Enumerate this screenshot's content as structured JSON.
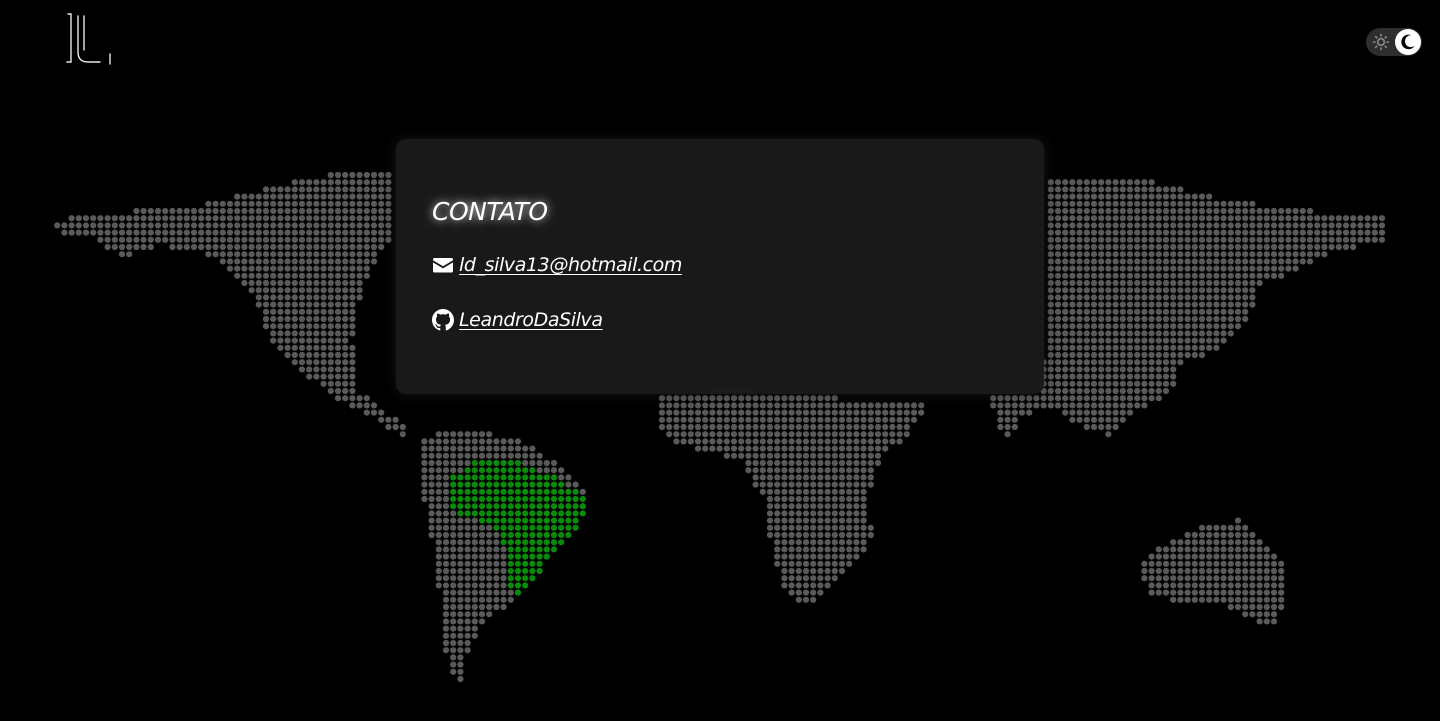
{
  "header": {
    "logo_icon": "ld-monogram-logo",
    "theme_toggle": {
      "icons": [
        "sun-icon",
        "moon-icon"
      ],
      "selected": "dark"
    }
  },
  "contact_card": {
    "title": "CONTATO",
    "email": {
      "icon": "envelope-icon",
      "label": "ld_silva13@hotmail.com"
    },
    "github": {
      "icon": "github-icon",
      "label": "LeandroDaSilva"
    }
  },
  "background_map": {
    "type": "dotted-world-map",
    "highlighted_country": "Brazil",
    "colors": {
      "background": "#000000",
      "dots": "#5a5a5a",
      "highlight": "#0a8a0a"
    }
  }
}
